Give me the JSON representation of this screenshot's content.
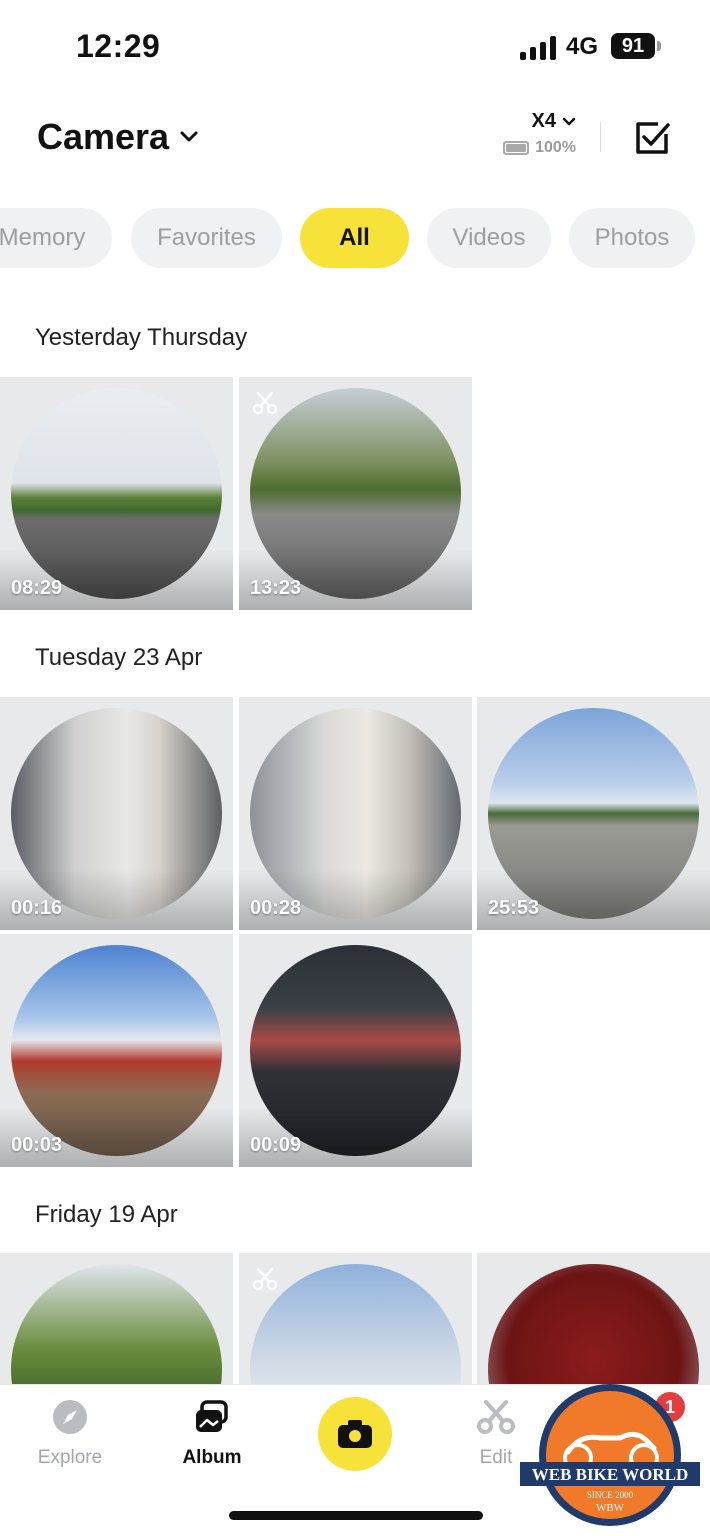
{
  "status": {
    "time": "12:29",
    "network": "4G",
    "battery": "91"
  },
  "header": {
    "title": "Camera",
    "device_name": "X4",
    "device_battery": "100%"
  },
  "filters": {
    "items": [
      "Memory",
      "Favorites",
      "All",
      "Videos",
      "Photos"
    ],
    "active": "All"
  },
  "sections": [
    {
      "title": "Yesterday Thursday",
      "items": [
        {
          "duration": "08:29",
          "edited": false,
          "thumb": "country-road"
        },
        {
          "duration": "13:23",
          "edited": true,
          "thumb": "tree-junction"
        }
      ]
    },
    {
      "title": "Tuesday 23 Apr",
      "items": [
        {
          "duration": "00:16",
          "edited": false,
          "thumb": "hallway-person"
        },
        {
          "duration": "00:28",
          "edited": false,
          "thumb": "hallway-door"
        },
        {
          "duration": "25:53",
          "edited": false,
          "thumb": "car-park"
        },
        {
          "duration": "00:03",
          "edited": false,
          "thumb": "motorcycle-shop"
        },
        {
          "duration": "00:09",
          "edited": false,
          "thumb": "office-desk"
        }
      ]
    },
    {
      "title": "Friday 19 Apr",
      "items": [
        {
          "duration": "",
          "edited": false,
          "thumb": "tree-lane"
        },
        {
          "duration": "",
          "edited": true,
          "thumb": "cloudy-hedge"
        },
        {
          "duration": "",
          "edited": false,
          "thumb": "red-cover"
        }
      ]
    }
  ],
  "tabbar": {
    "explore": "Explore",
    "album": "Album",
    "edit": "Edit",
    "active": "Album",
    "edit_badge": "1"
  },
  "watermark": {
    "name": "WEB BIKE WORLD",
    "since": "SINCE 2000",
    "short": "WBW"
  },
  "colors": {
    "accent": "#f7e23a",
    "chip_bg": "#f0f1f2",
    "tile_bg": "#e7e9ea"
  }
}
